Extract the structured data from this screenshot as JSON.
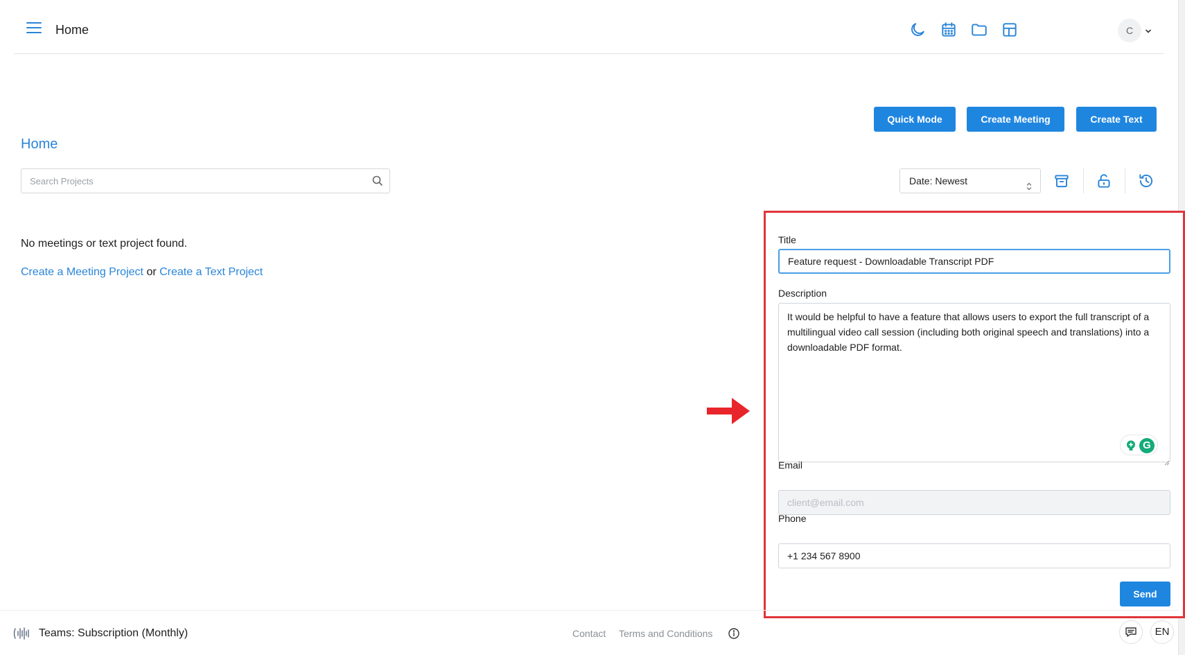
{
  "header": {
    "title": "Home",
    "avatar_initial": "C"
  },
  "actions": {
    "quick_mode": "Quick Mode",
    "create_meeting": "Create Meeting",
    "create_text": "Create Text"
  },
  "page": {
    "title": "Home"
  },
  "search": {
    "placeholder": "Search Projects",
    "value": ""
  },
  "sort": {
    "selected": "Date: Newest"
  },
  "empty_state": {
    "message": "No meetings or text project found.",
    "link_meeting": "Create a Meeting Project",
    "connector": "or",
    "link_text": "Create a Text Project"
  },
  "feedback_form": {
    "title_label": "Title",
    "title_value": "Feature request - Downloadable Transcript PDF",
    "description_label": "Description",
    "description_value": "It would be helpful to have a feature that allows users to export the full transcript of a multilingual video call session (including both original speech and translations) into a downloadable PDF format.",
    "email_label": "Email",
    "email_placeholder": "client@email.com",
    "phone_label": "Phone",
    "phone_value": "+1 234 567 8900",
    "send_label": "Send",
    "grammarly_letter": "G"
  },
  "footer": {
    "team_label": "Teams: Subscription (Monthly)",
    "contact": "Contact",
    "terms": "Terms and Conditions",
    "language": "EN"
  },
  "colors": {
    "accent": "#1f86e0",
    "highlight_border": "#e0353a",
    "arrow": "#e8252b"
  }
}
